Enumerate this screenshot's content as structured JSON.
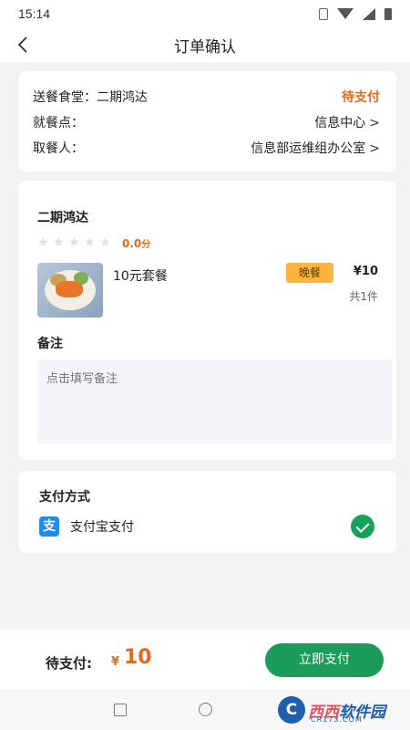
{
  "status_bar": {
    "time": "15:14"
  },
  "nav": {
    "title": "订单确认"
  },
  "info": {
    "canteen_label": "送餐食堂：",
    "canteen_value": "二期鸿达",
    "status": "待支付",
    "dining_point_label": "就餐点：",
    "dining_point_value": "信息中心",
    "pickup_label": "取餐人：",
    "pickup_value": "信息部运维组办公室"
  },
  "order": {
    "shop_name": "二期鸿达",
    "rating": "0.0",
    "rating_unit": "分",
    "item": {
      "name": "10元套餐",
      "tag": "晚餐",
      "price": "¥10",
      "count": "共1件"
    },
    "remark_label": "备注",
    "remark_placeholder": "点击填写备注"
  },
  "payment": {
    "title": "支付方式",
    "method_icon_char": "支",
    "method": "支付宝支付"
  },
  "bottom": {
    "total_label": "待支付:",
    "currency": "¥",
    "amount": "10",
    "pay_button": "立即支付"
  },
  "watermark": {
    "logo_char": "C",
    "text_a": "西西",
    "text_b": "软件园",
    "sub": "CR173.COM"
  },
  "colors": {
    "accent_orange": "#e06a1e",
    "primary_green": "#1b9c5a",
    "tag_yellow": "#f9b441",
    "alipay_blue": "#1c8cf3"
  }
}
